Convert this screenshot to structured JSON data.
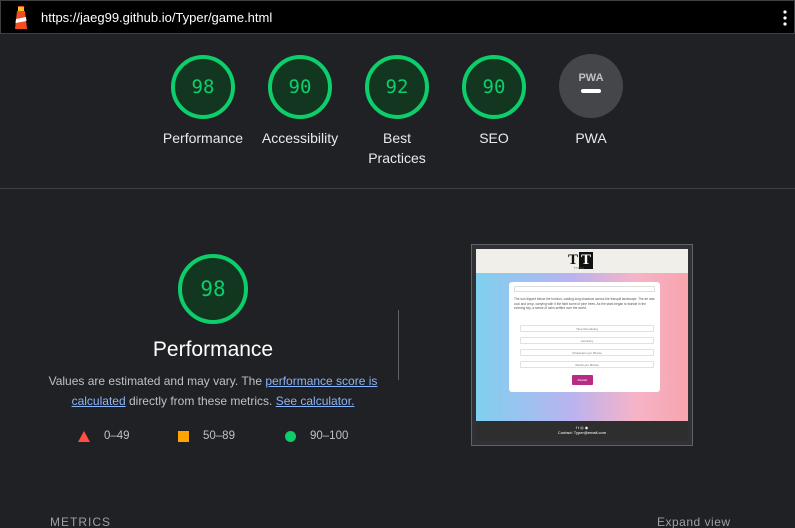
{
  "browser": {
    "url": "https://jaeg99.github.io/Typer/game.html",
    "logo_icon": "lighthouse-icon",
    "menu_icon": "kebab-menu-icon"
  },
  "gauges": [
    {
      "score": "98",
      "label": "Performance"
    },
    {
      "score": "90",
      "label": "Accessibility"
    },
    {
      "score": "92",
      "label": "Best\nPractices"
    },
    {
      "score": "90",
      "label": "SEO"
    },
    {
      "score": "PWA",
      "label": "PWA"
    }
  ],
  "colors": {
    "pass": "#0cce6b",
    "pass_fill": "#12361f",
    "average": "#ffa400",
    "fail": "#ff4e42",
    "pwa_bg": "#44464a"
  },
  "performance": {
    "score": "98",
    "title": "Performance",
    "desc_1": "Values are estimated and may vary. The ",
    "link_score": "performance score is calculated",
    "desc_2": " directly from these metrics. ",
    "link_calc": "See calculator."
  },
  "legend": [
    {
      "range": "0–49",
      "icon": "triangle-icon"
    },
    {
      "range": "50–89",
      "icon": "square-icon"
    },
    {
      "range": "90–100",
      "icon": "circle-icon"
    }
  ],
  "thumbnail": {
    "logo_t1": "T",
    "logo_t2": "T",
    "subtitle": "TYPER",
    "passage": "The sun dipped below the horizon, casting long shadows across the tranquil landscape. The air was cool and crisp, carrying with it the faint scent of pine trees. As the stars began to twinkle in the evening sky, a sense of calm settled over the world.",
    "time_field": "Time Remaining",
    "rows": [
      "Accuracy",
      "Characters per Minute",
      "Words per Minute"
    ],
    "button": "Restart",
    "footer_icons": "f  t  ◎  ◉",
    "footer_text": "Contact: Typer@email.com"
  },
  "bottom": {
    "metrics": "METRICS",
    "expand": "Expand view"
  }
}
